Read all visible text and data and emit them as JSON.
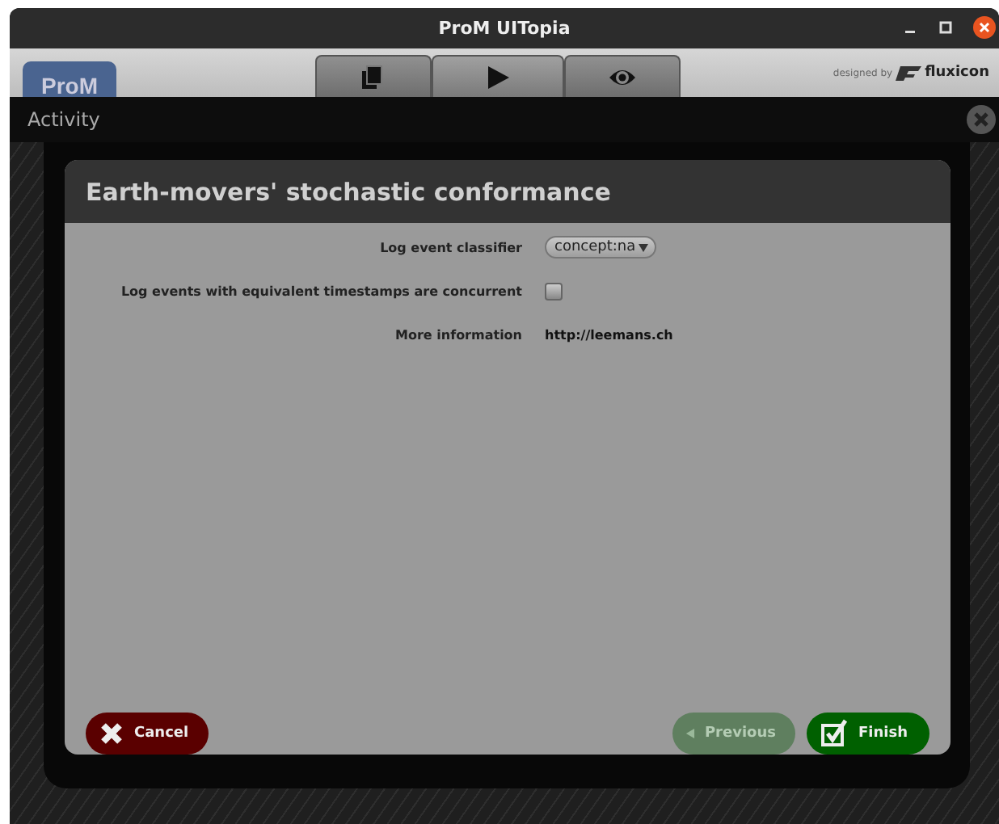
{
  "window": {
    "title": "ProM UITopia"
  },
  "logo": {
    "text": "ProM"
  },
  "tabs": [
    {
      "kind": "copies",
      "selected": false
    },
    {
      "kind": "play",
      "selected": true
    },
    {
      "kind": "eye",
      "selected": false
    }
  ],
  "credit": {
    "prefix": "designed by",
    "brand": "fluxicon"
  },
  "activity_bar": {
    "title": "Activity"
  },
  "dialog": {
    "title": "Earth-movers' stochastic conformance",
    "rows": [
      {
        "kind": "dropdown",
        "label": "Log event classifier",
        "value": "concept:na"
      },
      {
        "kind": "checkbox",
        "label": "Log events with equivalent timestamps are concurrent",
        "checked": false
      },
      {
        "kind": "link",
        "label": "More information",
        "value": "http://leemans.ch"
      }
    ],
    "buttons": [
      {
        "kind": "cancel",
        "label": "Cancel",
        "disabled": false
      },
      {
        "kind": "previous",
        "label": "Previous",
        "disabled": true
      },
      {
        "kind": "finish",
        "label": "Finish",
        "disabled": false
      }
    ]
  }
}
